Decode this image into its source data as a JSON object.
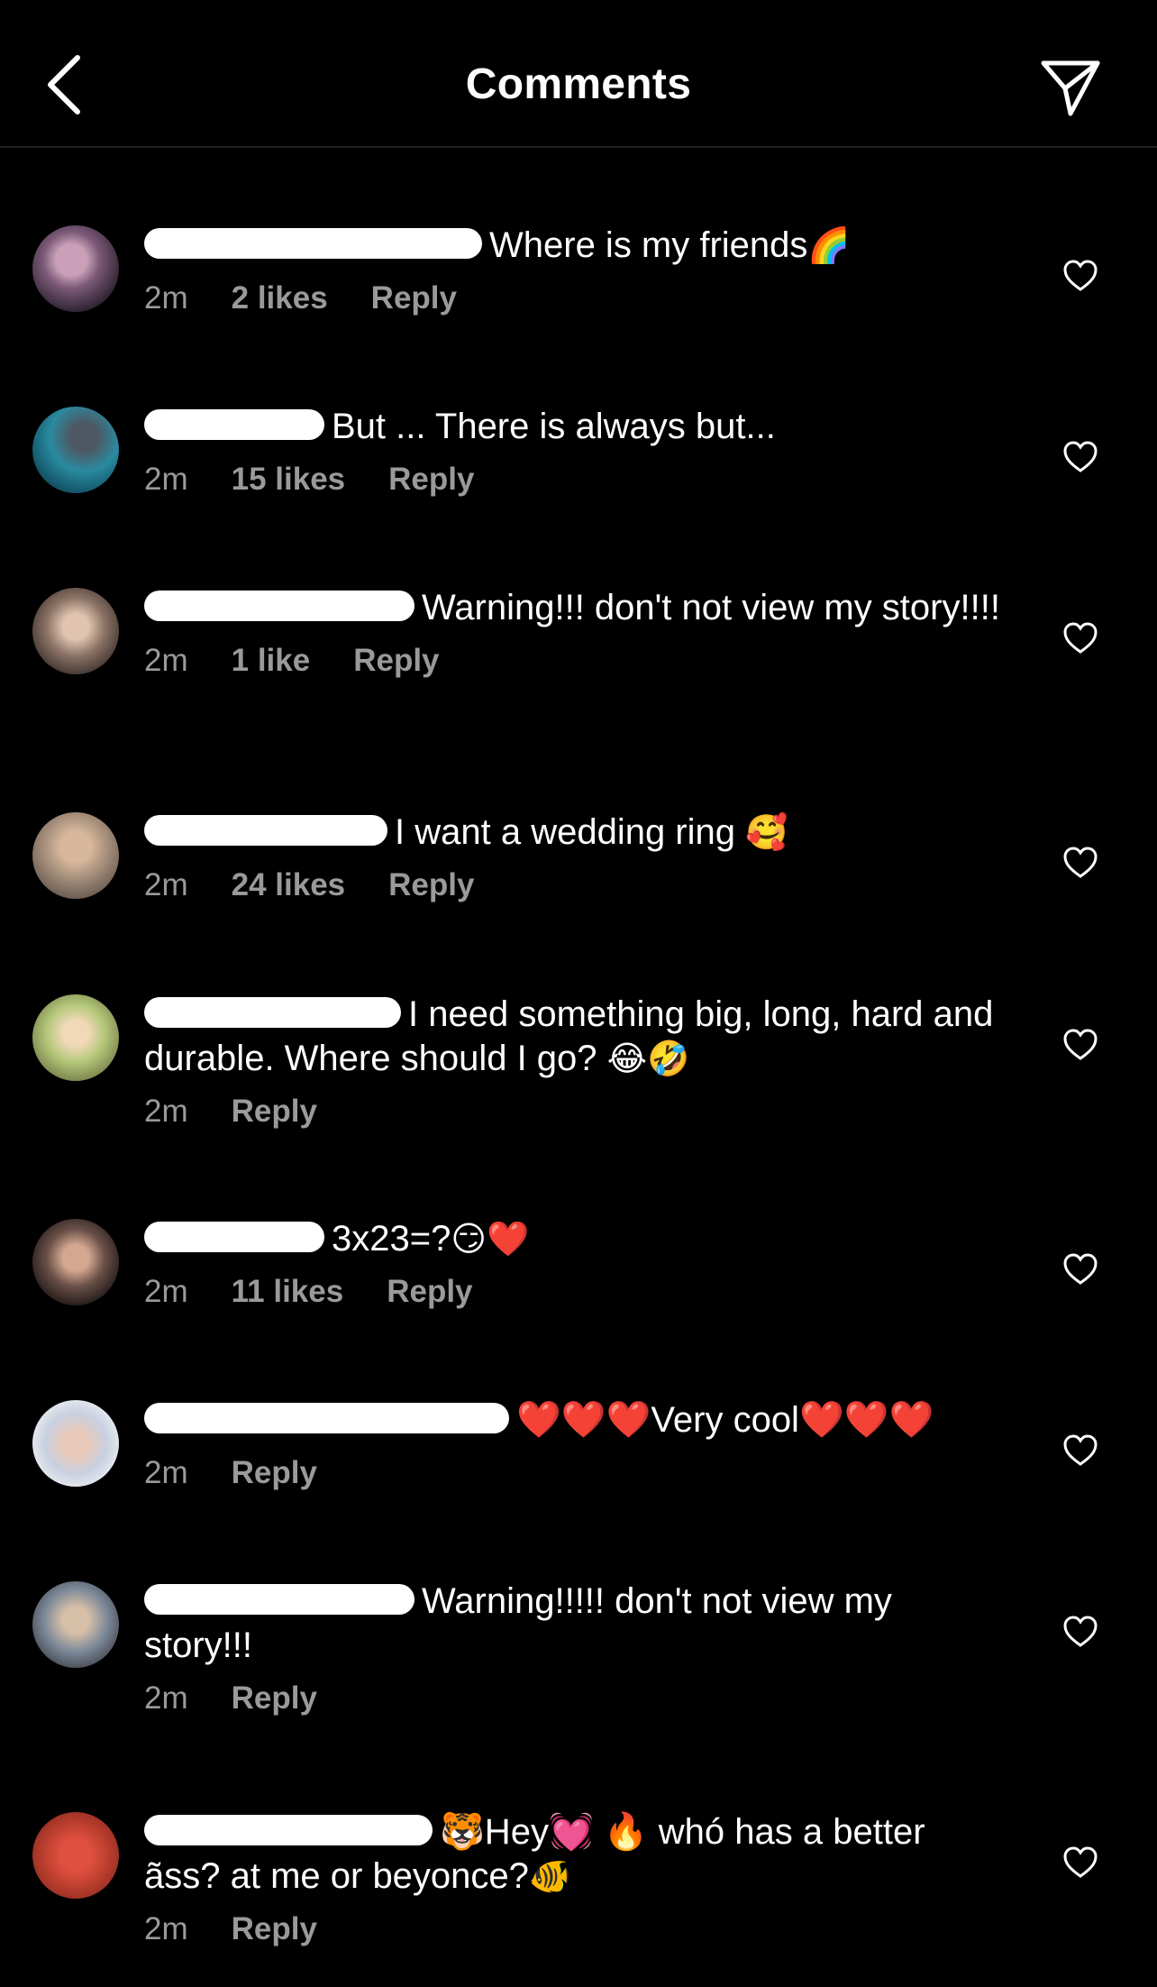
{
  "header": {
    "title": "Comments"
  },
  "comments": [
    {
      "text": "Where is my friends",
      "emoji": "🌈",
      "time": "2m",
      "likes": "2 likes",
      "reply": "Reply"
    },
    {
      "text": "But ... There is always but...",
      "emoji": "",
      "time": "2m",
      "likes": "15 likes",
      "reply": "Reply"
    },
    {
      "text": "Warning!!! don't not view my story!!!!",
      "emoji": "",
      "time": "2m",
      "likes": "1 like",
      "reply": "Reply"
    },
    {
      "text": "I want a wedding ring",
      "emoji": "🥰",
      "time": "2m",
      "likes": "24 likes",
      "reply": "Reply"
    },
    {
      "text": "I need something big, long, hard and durable. Where should I go?",
      "emoji": "😂🤣",
      "time": "2m",
      "likes": "",
      "reply": "Reply"
    },
    {
      "text": "3x23=?",
      "emoji": "😏❤️",
      "time": "2m",
      "likes": "11 likes",
      "reply": "Reply"
    },
    {
      "text": "❤️❤️❤️Very cool❤️❤️❤️",
      "emoji": "",
      "time": "2m",
      "likes": "",
      "reply": "Reply"
    },
    {
      "text": "Warning!!!!! don't not view my story!!!",
      "emoji": "",
      "time": "2m",
      "likes": "",
      "reply": "Reply"
    },
    {
      "text": "🐯Hey💓 🔥 whó has a better ãss? at me or beyonce?",
      "emoji": "🐠",
      "time": "2m",
      "likes": "",
      "reply": "Reply"
    }
  ],
  "icons": {
    "back": "chevron-left-icon",
    "send": "paper-plane-icon",
    "like": "heart-outline-icon"
  },
  "colors": {
    "background": "#000000",
    "text": "#ffffff",
    "meta": "#9a9a9a"
  }
}
